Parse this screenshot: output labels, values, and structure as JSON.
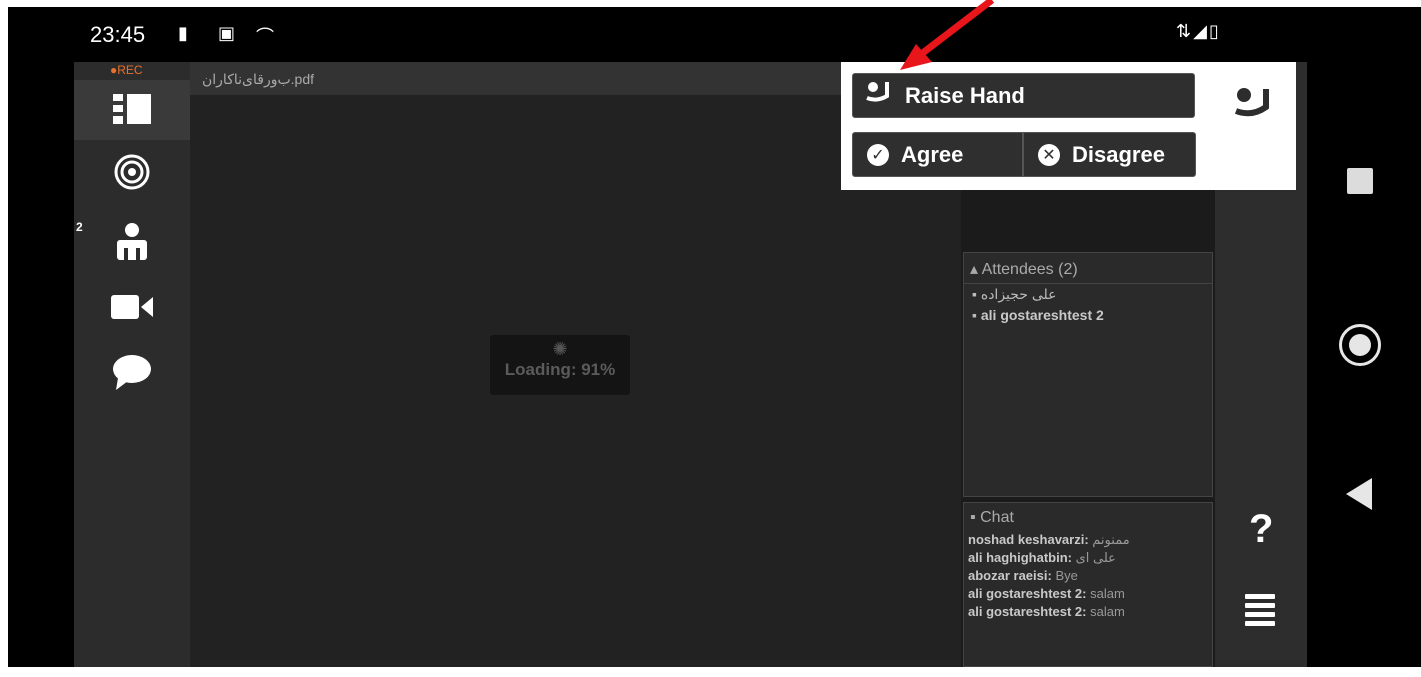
{
  "status_bar": {
    "time": "23:45",
    "left_icons": [
      "battery-alert-icon",
      "image-icon",
      "call-end-icon"
    ],
    "right_icons": [
      "signal-wifi-icon",
      "cellular-icon",
      "battery-icon"
    ]
  },
  "sidebar": {
    "rec_label": "●REC",
    "attendees_badge": "2",
    "items": [
      {
        "icon": "layout-icon",
        "active": true
      },
      {
        "icon": "broadcast-icon",
        "active": false
      },
      {
        "icon": "user-icon",
        "active": false
      },
      {
        "icon": "video-camera-icon",
        "active": false
      },
      {
        "icon": "chat-bubble-icon",
        "active": false
      }
    ]
  },
  "document": {
    "title": "ب‌ورقای‌ناکارا‌ن.pdf",
    "loading_text": "Loading: 91%"
  },
  "attendees": {
    "title": "Attendees",
    "count": "(2)",
    "list": [
      {
        "name": "علی حجیزاده",
        "bold": false
      },
      {
        "name": "ali gostareshtest 2",
        "bold": true
      }
    ]
  },
  "chat": {
    "title": "Chat",
    "messages": [
      {
        "user": "noshad keshavarzi:",
        "text": "ممنونم"
      },
      {
        "user": "ali haghighatbin:",
        "text": "علی ای"
      },
      {
        "user": "abozar raeisi:",
        "text": "Bye"
      },
      {
        "user": "ali gostareshtest 2:",
        "text": "salam"
      },
      {
        "user": "ali gostareshtest 2:",
        "text": "salam"
      }
    ]
  },
  "popup": {
    "raise_hand_label": "Raise Hand",
    "agree_label": "Agree",
    "disagree_label": "Disagree"
  },
  "right_strip": {
    "help_label": "?"
  },
  "colors": {
    "accent_rec": "#e8702a",
    "arrow": "#e8151b"
  }
}
